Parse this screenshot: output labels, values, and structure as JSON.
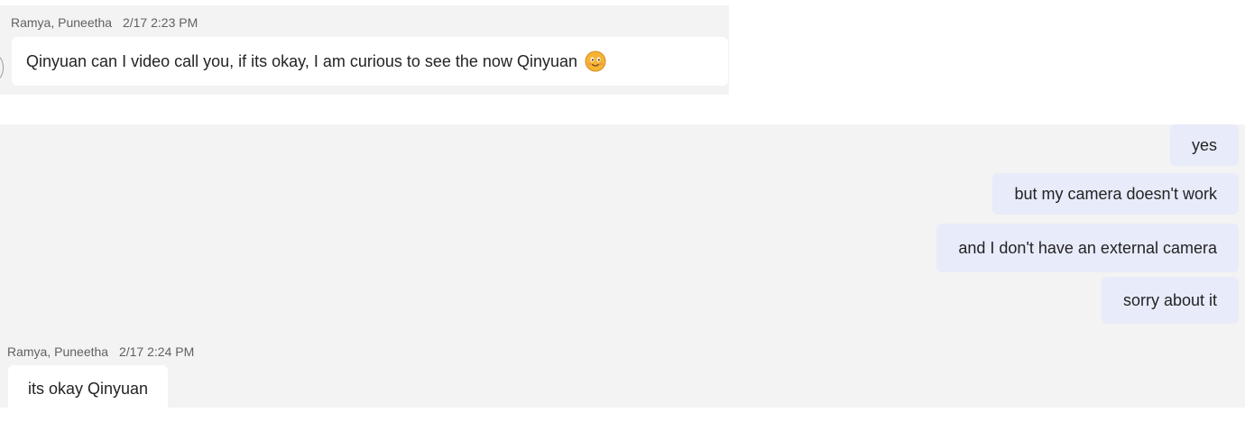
{
  "messages_top": {
    "sender": "Ramya, Puneetha",
    "timestamp": "2/17 2:23 PM",
    "text": "Qinyuan can I video call you, if its okay, I am curious to see the now Qinyuan",
    "emoji": "smiling-face-emoji"
  },
  "outgoing": [
    {
      "text": "yes"
    },
    {
      "text": "but my camera doesn't work"
    },
    {
      "text": "and I don't have an external camera"
    },
    {
      "text": "sorry about it"
    }
  ],
  "messages_bottom": {
    "sender": "Ramya, Puneetha",
    "timestamp": "2/17 2:24 PM",
    "text": "its okay Qinyuan"
  },
  "colors": {
    "panel_bg": "#f3f3f3",
    "incoming_bubble": "#ffffff",
    "outgoing_bubble": "#e8ebfa",
    "meta_text": "#616161",
    "body_text": "#242424"
  }
}
